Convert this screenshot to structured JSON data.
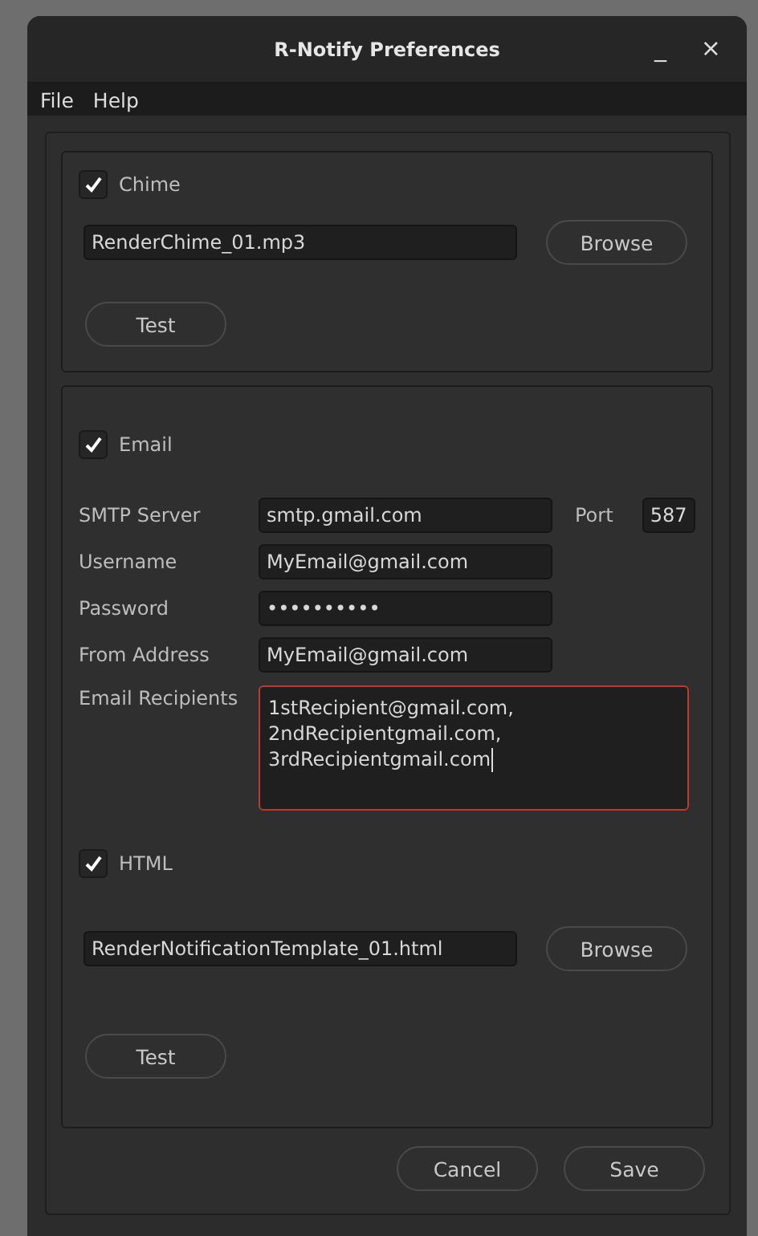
{
  "window": {
    "title": "R-Notify Preferences",
    "minimize": "_",
    "close": "×"
  },
  "menu": [
    {
      "label": "File"
    },
    {
      "label": "Help"
    }
  ],
  "chime": {
    "label": "Chime",
    "checked": true,
    "file": "RenderChime_01.mp3",
    "browse": "Browse",
    "test": "Test"
  },
  "email": {
    "label": "Email",
    "checked": true,
    "smtp": {
      "label": "SMTP Server",
      "value": "smtp.gmail.com"
    },
    "port": {
      "label": "Port",
      "value": "587"
    },
    "fields": [
      {
        "label": "Username",
        "value": "MyEmail@gmail.com"
      },
      {
        "label": "Password",
        "value": "••••••••••"
      },
      {
        "label": "From Address",
        "value": "MyEmail@gmail.com"
      }
    ],
    "recipients": {
      "label": "Email Recipients",
      "error": true,
      "lines": [
        "1stRecipient@gmail.com,",
        "2ndRecipientgmail.com,",
        "3rdRecipientgmail.com"
      ]
    },
    "html": {
      "label": "HTML",
      "checked": true,
      "file": "RenderNotificationTemplate_01.html",
      "browse": "Browse",
      "test": "Test"
    }
  },
  "buttons": [
    {
      "label": "Cancel"
    },
    {
      "label": "Save"
    }
  ]
}
